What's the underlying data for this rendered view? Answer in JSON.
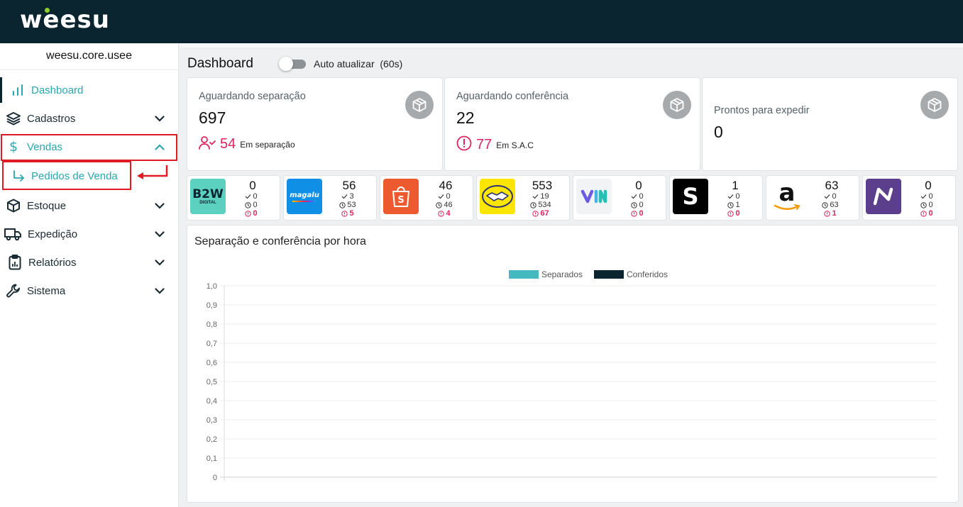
{
  "brand": {
    "name": "weesu"
  },
  "sidebar": {
    "org": "weesu.core.usee",
    "items": [
      {
        "label": "Dashboard"
      },
      {
        "label": "Cadastros"
      },
      {
        "label": "Vendas"
      },
      {
        "label": "Pedidos de Venda"
      },
      {
        "label": "Estoque"
      },
      {
        "label": "Expedição"
      },
      {
        "label": "Relatórios"
      },
      {
        "label": "Sistema"
      }
    ]
  },
  "header": {
    "title": "Dashboard",
    "auto_update_label": "Auto atualizar",
    "auto_update_interval": "(60s)",
    "auto_update_on": false
  },
  "cards": [
    {
      "title": "Aguardando separação",
      "value": "697",
      "sub_value": "54",
      "sub_label": "Em separação"
    },
    {
      "title": "Aguardando conferência",
      "value": "22",
      "sub_value": "77",
      "sub_label": "Em S.A.C"
    },
    {
      "title": "Prontos para expedir",
      "value": "0"
    }
  ],
  "marketplaces": [
    {
      "name": "B2W Digital",
      "total": "0",
      "separated": "0",
      "pending": "0",
      "alert": "0"
    },
    {
      "name": "Magalu",
      "total": "56",
      "separated": "3",
      "pending": "53",
      "alert": "5"
    },
    {
      "name": "Shopee",
      "total": "46",
      "separated": "0",
      "pending": "46",
      "alert": "4"
    },
    {
      "name": "Mercado Livre",
      "total": "553",
      "separated": "19",
      "pending": "534",
      "alert": "67"
    },
    {
      "name": "Via",
      "total": "0",
      "separated": "0",
      "pending": "0",
      "alert": "0"
    },
    {
      "name": "Shein",
      "total": "1",
      "separated": "0",
      "pending": "1",
      "alert": "0"
    },
    {
      "name": "Amazon",
      "total": "63",
      "separated": "0",
      "pending": "63",
      "alert": "1"
    },
    {
      "name": "Netshoes",
      "total": "0",
      "separated": "0",
      "pending": "0",
      "alert": "0"
    }
  ],
  "chart_data": {
    "type": "bar",
    "title": "Separação e conferência por hora",
    "xlabel": "",
    "ylabel": "",
    "categories": [],
    "series": [
      {
        "name": "Separados",
        "values": [],
        "color": "#45b9c0"
      },
      {
        "name": "Conferidos",
        "values": [],
        "color": "#0b2530"
      }
    ],
    "ylim": [
      0,
      1
    ],
    "yticks": [
      "1,0",
      "0,9",
      "0,8",
      "0,7",
      "0,6",
      "0,5",
      "0,4",
      "0,3",
      "0,2",
      "0,1",
      "0"
    ],
    "grid": true,
    "legend": "top-center"
  },
  "colors": {
    "topbar": "#0b2530",
    "accent": "#2ba6ad",
    "alert": "#e0245e",
    "highlight": "#e01b24"
  }
}
